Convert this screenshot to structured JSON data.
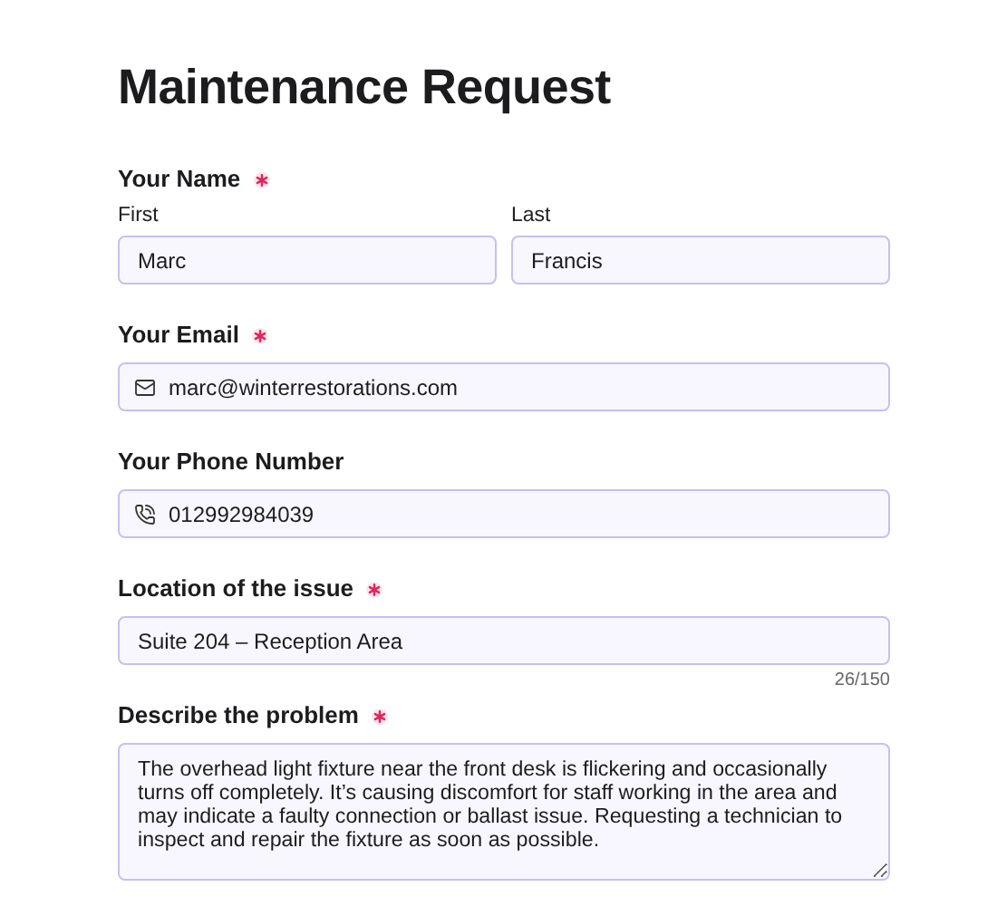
{
  "title": "Maintenance Request",
  "fields": [
    {
      "kind": "name",
      "label": "Your Name",
      "required": true,
      "parts": [
        {
          "label": "First",
          "value": "Marc"
        },
        {
          "label": "Last",
          "value": "Francis"
        }
      ]
    },
    {
      "kind": "email",
      "label": "Your Email",
      "required": true,
      "value": "marc@winterrestorations.com"
    },
    {
      "kind": "phone",
      "label": "Your Phone Number",
      "required": false,
      "value": "012992984039"
    },
    {
      "kind": "text",
      "label": "Location of the issue",
      "required": true,
      "value": "Suite 204 – Reception Area",
      "counter": "26/150"
    },
    {
      "kind": "textarea",
      "label": "Describe the problem",
      "required": true,
      "value": "The overhead light fixture near the front desk is flickering and occasionally turns off completely. It’s causing discomfort for staff working in the area and may indicate a faulty connection or ballast issue. Requesting a technician to inspect and repair the fixture as soon as possible."
    }
  ]
}
